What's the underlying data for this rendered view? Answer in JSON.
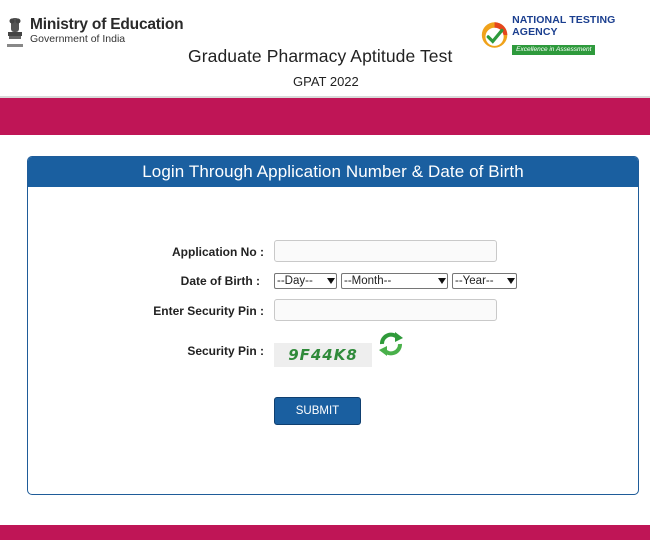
{
  "header": {
    "ministry_line1": "Ministry of Education",
    "ministry_line2": "Government of India",
    "nta_name": "NATIONAL TESTING AGENCY",
    "nta_tagline": "Excellence in Assessment",
    "exam_title": "Graduate Pharmacy Aptitude Test",
    "exam_code": "GPAT 2022"
  },
  "login": {
    "heading": "Login Through Application Number & Date of Birth",
    "app_no_label": "Application No :",
    "app_no_value": "",
    "dob_label": "Date of Birth :",
    "day_selected": "--Day--",
    "month_selected": "--Month--",
    "year_selected": "--Year--",
    "enter_pin_label": "Enter Security Pin :",
    "enter_pin_value": "",
    "security_pin_label": "Security Pin :",
    "captcha_text": "9F44K8",
    "submit_label": "SUBMIT"
  },
  "colors": {
    "band": "#bf1556",
    "panel_header": "#1a5fa0",
    "captcha_text": "#2f8a3a"
  },
  "icons": {
    "emblem": "national-emblem-icon",
    "nta_logo": "nta-logo-icon",
    "refresh": "refresh-icon"
  }
}
